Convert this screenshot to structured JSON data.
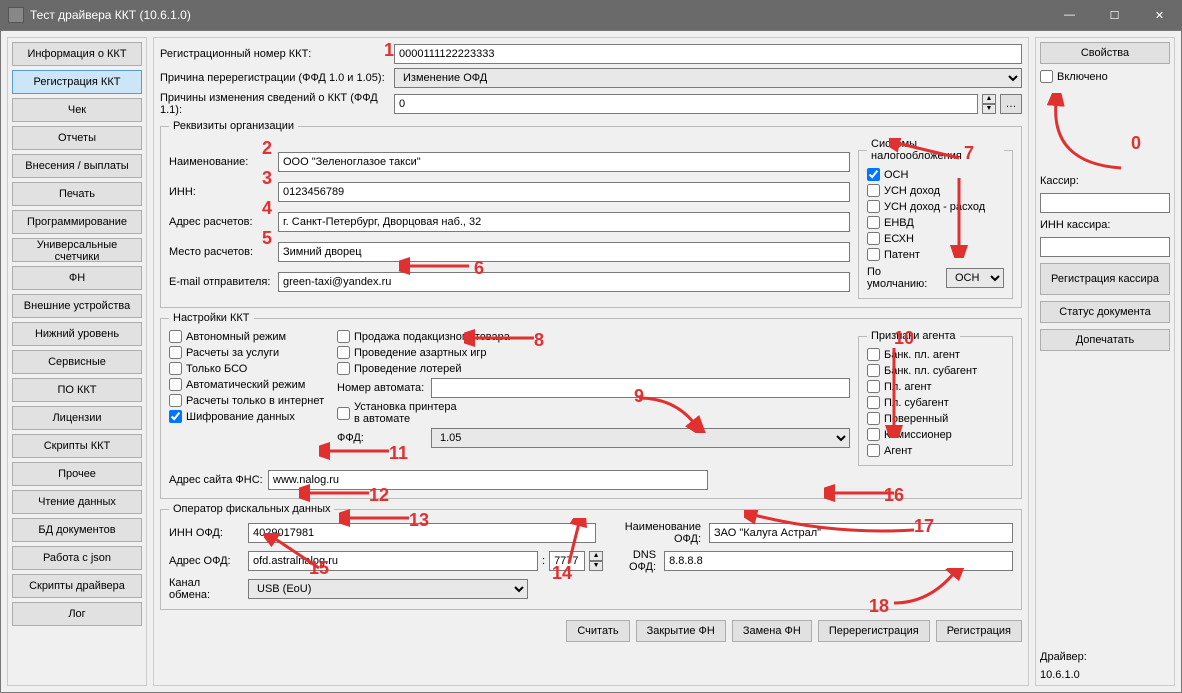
{
  "window": {
    "title": "Тест драйвера ККТ (10.6.1.0)"
  },
  "sidebar": {
    "items": [
      "Информация о ККТ",
      "Регистрация ККТ",
      "Чек",
      "Отчеты",
      "Внесения / выплаты",
      "Печать",
      "Программирование",
      "Универсальные счетчики",
      "ФН",
      "Внешние устройства",
      "Нижний уровень",
      "Сервисные",
      "ПО ККТ",
      "Лицензии",
      "Скрипты ККТ",
      "Прочее",
      "Чтение данных",
      "БД документов",
      "Работа с json",
      "Скрипты драйвера",
      "Лог"
    ],
    "active_index": 1
  },
  "top": {
    "reg_num_label": "Регистрационный номер ККТ:",
    "reg_num_value": "0000111122223333",
    "rereg_reason_label": "Причина перерегистрации (ФФД 1.0 и 1.05):",
    "rereg_reason_value": "Изменение ОФД",
    "change_reasons_label": "Причины изменения сведений о ККТ (ФФД 1.1):",
    "change_reasons_value": "0"
  },
  "org": {
    "legend": "Реквизиты организации",
    "name_label": "Наименование:",
    "name_value": "ООО \"Зеленоглазое такси\"",
    "inn_label": "ИНН:",
    "inn_value": "0123456789",
    "addr_label": "Адрес расчетов:",
    "addr_value": "г. Санкт-Петербург, Дворцовая наб., 32",
    "place_label": "Место расчетов:",
    "place_value": "Зимний дворец",
    "email_label": "E-mail отправителя:",
    "email_value": "green-taxi@yandex.ru",
    "tax_legend": "Системы налогообложения",
    "tax_items": [
      "ОСН",
      "УСН доход",
      "УСН доход - расход",
      "ЕНВД",
      "ЕСХН",
      "Патент"
    ],
    "tax_checked": [
      true,
      false,
      false,
      false,
      false,
      false
    ],
    "tax_default_label": "По умолчанию:",
    "tax_default_value": "ОСН"
  },
  "kkt": {
    "legend": "Настройки ККТ",
    "left": [
      "Автономный режим",
      "Расчеты за услуги",
      "Только БСО",
      "Автоматический режим",
      "Расчеты только в интернет",
      "Шифрование данных"
    ],
    "left_checked": [
      false,
      false,
      false,
      false,
      false,
      true
    ],
    "mid": [
      "Продажа подакцизного товара",
      "Проведение азартных игр",
      "Проведение лотерей"
    ],
    "mid_checked": [
      false,
      false,
      false
    ],
    "automat_label": "Номер автомата:",
    "automat_value": "",
    "printer_label": "Установка принтера в автомате",
    "printer_checked": false,
    "ffd_label": "ФФД:",
    "ffd_value": "1.05",
    "fns_label": "Адрес сайта ФНС:",
    "fns_value": "www.nalog.ru",
    "agent_legend": "Признаки агента",
    "agent_items": [
      "Банк. пл. агент",
      "Банк. пл. субагент",
      "Пл. агент",
      "Пл. субагент",
      "Поверенный",
      "Комиссионер",
      "Агент"
    ]
  },
  "ofd": {
    "legend": "Оператор фискальных данных",
    "inn_label": "ИНН ОФД:",
    "inn_value": "4029017981",
    "name_label": "Наименование ОФД:",
    "name_value": "ЗАО \"Калуга Астрал\"",
    "addr_label": "Адрес ОФД:",
    "addr_value": "ofd.astralnalog.ru",
    "port_value": "7777",
    "dns_label": "DNS ОФД:",
    "dns_value": "8.8.8.8",
    "channel_label": "Канал обмена:",
    "channel_value": "USB (EoU)"
  },
  "actions": {
    "read": "Считать",
    "close_fn": "Закрытие ФН",
    "replace_fn": "Замена ФН",
    "rereg": "Перерегистрация",
    "reg": "Регистрация"
  },
  "right": {
    "props": "Свойства",
    "enabled_label": "Включено",
    "cashier_label": "Кассир:",
    "cashier_value": "",
    "cashier_inn_label": "ИНН кассира:",
    "cashier_inn_value": "",
    "reg_cashier": "Регистрация кассира",
    "doc_status": "Статус документа",
    "reprint": "Допечатать",
    "driver_label": "Драйвер:",
    "driver_ver": "10.6.1.0"
  },
  "annotations": {
    "0": "0",
    "1": "1",
    "2": "2",
    "3": "3",
    "4": "4",
    "5": "5",
    "6": "6",
    "7": "7",
    "8": "8",
    "9": "9",
    "10": "10",
    "11": "11",
    "12": "12",
    "13": "13",
    "14": "14",
    "15": "15",
    "16": "16",
    "17": "17",
    "18": "18"
  }
}
